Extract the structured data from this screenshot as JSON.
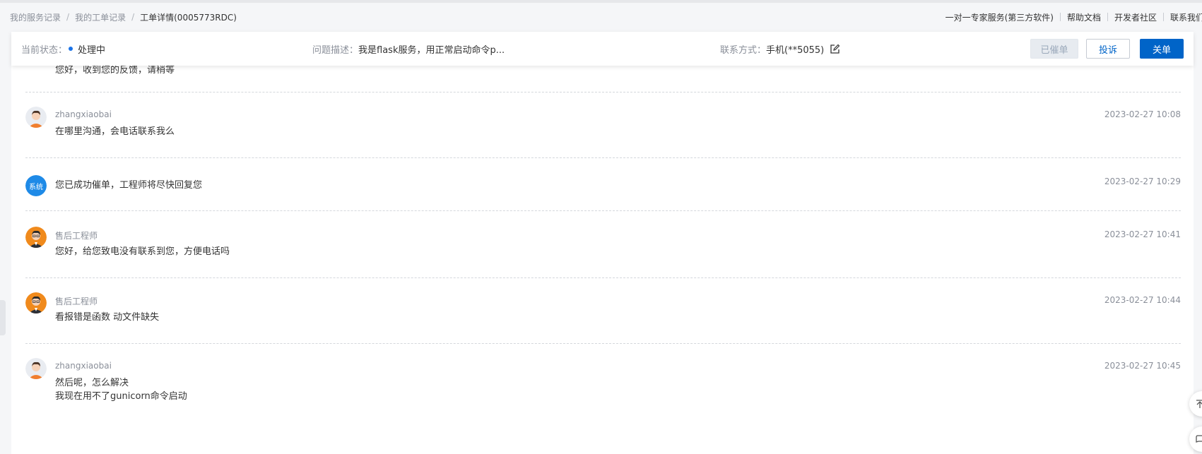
{
  "breadcrumb": {
    "items": [
      "我的服务记录",
      "我的工单记录"
    ],
    "current": "工单详情(0005773RDC)",
    "separator": "/"
  },
  "top_links": [
    "一对一专家服务(第三方软件)",
    "帮助文档",
    "开发者社区",
    "联系我们"
  ],
  "status_bar": {
    "status_label": "当前状态：",
    "status_value": "处理中",
    "desc_label": "问题描述：",
    "desc_value": "我是flask服务，用正常启动命令p...",
    "contact_label": "联系方式：",
    "contact_value": "手机(**5055)",
    "buttons": {
      "urged": "已催单",
      "complain": "投诉",
      "close": "关单"
    }
  },
  "messages": [
    {
      "sender": "",
      "text": "您好，收到您的反馈，请稍等",
      "time": "",
      "avatar": "engineer-avatar"
    },
    {
      "sender": "zhangxiaobai",
      "text": "在哪里沟通，会电话联系我么",
      "time": "2023-02-27 10:08",
      "avatar": "user-avatar"
    },
    {
      "sender": "",
      "text": "您已成功催单，工程师将尽快回复您",
      "time": "2023-02-27 10:29",
      "avatar": "system-badge",
      "badge": "系统"
    },
    {
      "sender": "售后工程师",
      "text": "您好，给您致电没有联系到您，方便电话吗",
      "time": "2023-02-27 10:41",
      "avatar": "engineer-avatar"
    },
    {
      "sender": "售后工程师",
      "text": "看报错是函数 动文件缺失",
      "time": "2023-02-27 10:44",
      "avatar": "engineer-avatar"
    },
    {
      "sender": "zhangxiaobai",
      "text": "然后呢，怎么解决",
      "text2": "我现在用不了gunicorn命令启动",
      "time": "2023-02-27 10:45",
      "avatar": "user-avatar"
    }
  ],
  "colors": {
    "primary": "#0064c8",
    "status_dot": "#1a73e8",
    "system_badge": "#1e8ae7"
  }
}
